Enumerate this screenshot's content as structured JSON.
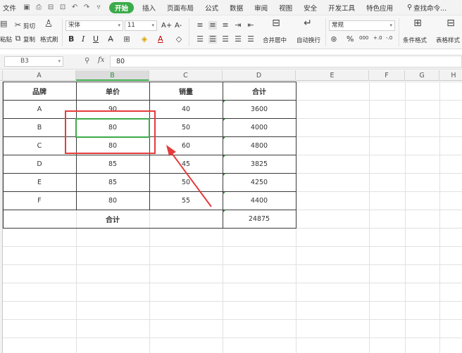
{
  "menubar": {
    "file_label": "文件",
    "tabs": [
      {
        "label": "开始",
        "active": true
      },
      {
        "label": "插入",
        "active": false
      },
      {
        "label": "页面布局",
        "active": false
      },
      {
        "label": "公式",
        "active": false
      },
      {
        "label": "数据",
        "active": false
      },
      {
        "label": "审阅",
        "active": false
      },
      {
        "label": "视图",
        "active": false
      },
      {
        "label": "安全",
        "active": false
      },
      {
        "label": "开发工具",
        "active": false
      },
      {
        "label": "特色应用",
        "active": false
      }
    ],
    "search_label": "查找命令..."
  },
  "ribbon": {
    "cut_label": "剪切",
    "paste_label": "粘贴",
    "copy_label": "复制",
    "format_painter_label": "格式刷",
    "font_name": "宋体",
    "font_size": "11",
    "bold_label": "B",
    "italic_label": "I",
    "underline_label": "U",
    "grow_font_label": "A+",
    "shrink_font_label": "A-",
    "font_color_label": "A",
    "merge_center_label": "合并居中",
    "wrap_text_label": "自动换行",
    "number_format": "常规",
    "percent_label": "%",
    "thousands_label": "000",
    "inc_decimal_label": "+.0",
    "dec_decimal_label": "-.0",
    "cond_format_label": "条件格式",
    "table_style_label": "表格样式"
  },
  "formula_bar": {
    "cell_ref": "B3",
    "fx_label": "fx",
    "value": "80"
  },
  "columns": [
    "A",
    "B",
    "C",
    "D",
    "E",
    "F",
    "G",
    "H"
  ],
  "selected_column": "B",
  "table": {
    "headers": [
      "品牌",
      "单价",
      "销量",
      "合计"
    ],
    "rows": [
      [
        "A",
        "90",
        "40",
        "3600"
      ],
      [
        "B",
        "80",
        "50",
        "4000"
      ],
      [
        "C",
        "80",
        "60",
        "4800"
      ],
      [
        "D",
        "85",
        "45",
        "3825"
      ],
      [
        "E",
        "85",
        "50",
        "4250"
      ],
      [
        "F",
        "80",
        "55",
        "4400"
      ]
    ],
    "total_label": "合计",
    "total_value": "24875"
  },
  "colors": {
    "accent_green": "#3cab4a",
    "annotation_red": "#e53b3b"
  }
}
